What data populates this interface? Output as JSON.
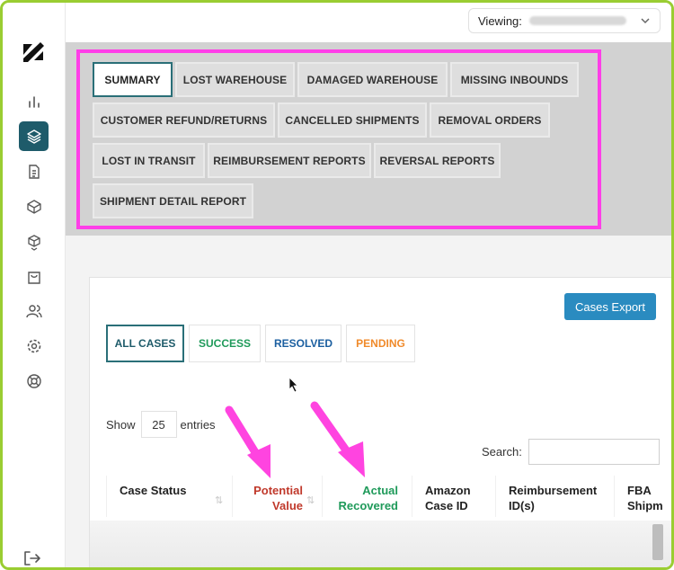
{
  "header": {
    "viewing_label": "Viewing:"
  },
  "report_tabs": [
    {
      "label": "SUMMARY"
    },
    {
      "label": "LOST WAREHOUSE"
    },
    {
      "label": "DAMAGED WAREHOUSE"
    },
    {
      "label": "MISSING INBOUNDS"
    },
    {
      "label": "CUSTOMER REFUND/RETURNS"
    },
    {
      "label": "CANCELLED SHIPMENTS"
    },
    {
      "label": "REMOVAL ORDERS"
    },
    {
      "label": "LOST IN TRANSIT"
    },
    {
      "label": "REIMBURSEMENT REPORTS"
    },
    {
      "label": "REVERSAL REPORTS"
    },
    {
      "label": "SHIPMENT DETAIL REPORT"
    }
  ],
  "cases": {
    "export_label": "Cases Export",
    "filters": [
      {
        "label": "ALL CASES",
        "color": "#1e5b6a"
      },
      {
        "label": "SUCCESS",
        "color": "#1f9a5a"
      },
      {
        "label": "RESOLVED",
        "color": "#1b5fa0"
      },
      {
        "label": "PENDING",
        "color": "#f08a2a"
      }
    ],
    "show_label": "Show",
    "page_length": "25",
    "entries_label": "entries",
    "search_label": "Search:",
    "columns": [
      {
        "label": "Case Status",
        "color": "#222222"
      },
      {
        "label": "Potential Value",
        "color": "#c0392b"
      },
      {
        "label": "Actual Recovered",
        "color": "#1f9a5a"
      },
      {
        "label": "Amazon Case ID",
        "color": "#222222"
      },
      {
        "label": "Reimbursement ID(s)",
        "color": "#222222"
      },
      {
        "label": "FBA Shipm",
        "color": "#222222"
      }
    ]
  },
  "colors": {
    "highlight_border": "#ff3ee8",
    "sidebar_active": "#1e5b6a",
    "export_button": "#2a8bc0",
    "annotation_arrow": "#ff44e0"
  }
}
